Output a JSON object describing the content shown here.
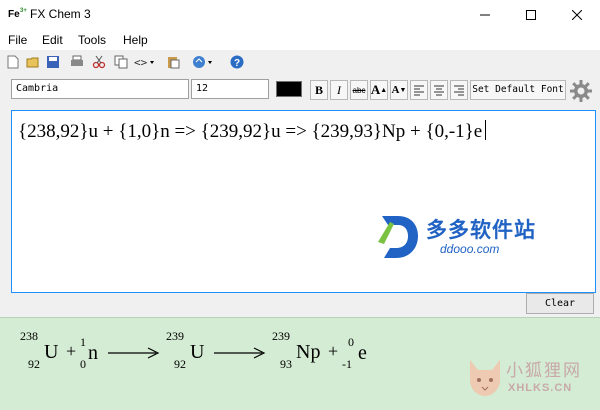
{
  "window": {
    "app_icon_text": "Fe",
    "app_icon_sup": "3+",
    "title": "FX Chem 3"
  },
  "menu": [
    "File",
    "Edit",
    "Tools",
    "Help"
  ],
  "toolbar_icons": [
    "new-file-icon",
    "open-folder-icon",
    "save-icon",
    "print-icon",
    "cut-icon",
    "copy-icon",
    "code-icon",
    "paste-icon",
    "browser-icon",
    "help-icon"
  ],
  "format": {
    "font_name": "Cambria",
    "font_size": "12",
    "text_color": "#000000",
    "bold_label": "B",
    "italic_label": "I",
    "strike_label": "abc",
    "grow_label": "A",
    "shrink_label": "A",
    "set_default_font_label": "Set Default Font"
  },
  "editor": {
    "text": "{238,92}u + {1,0}n => {239,92}u => {239,93}Np + {0,-1}e"
  },
  "clear_label": "Clear",
  "output": {
    "terms": [
      {
        "mass": "238",
        "atomic": "92",
        "symbol": "U"
      },
      {
        "mass": "1",
        "atomic": "0",
        "symbol": "n"
      },
      {
        "mass": "239",
        "atomic": "92",
        "symbol": "U"
      },
      {
        "mass": "239",
        "atomic": "93",
        "symbol": "Np"
      },
      {
        "mass": "0",
        "atomic": "-1",
        "symbol": "e"
      }
    ],
    "plus": "+"
  },
  "watermarks": {
    "top_text": "多多软件站",
    "top_url": "ddooo.com",
    "bottom_text": "小狐狸网",
    "bottom_url": "XHLKS.CN"
  },
  "colors": {
    "editor_border": "#1e90ff",
    "output_bg": "#d4ecd4",
    "watermark_blue": "#2163c4"
  }
}
